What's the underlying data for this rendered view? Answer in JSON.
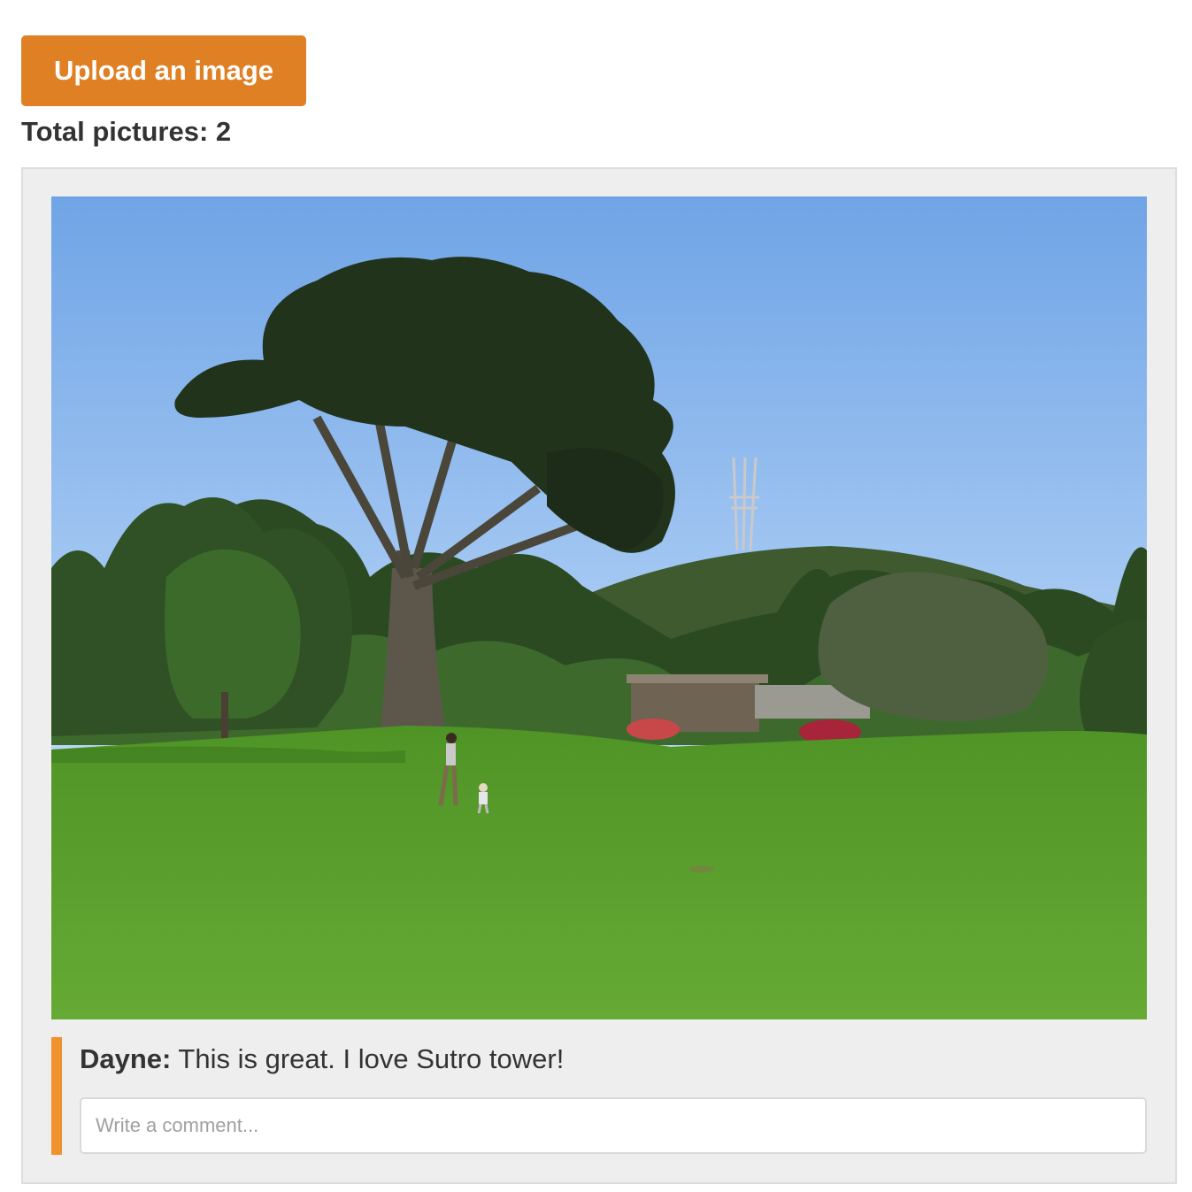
{
  "upload_button": {
    "label": "Upload an image"
  },
  "summary": {
    "total_label": "Total pictures: 2"
  },
  "post": {
    "image": {
      "subject": "park lawn with large cypress tree, person and child walking, Sutro tower on hill",
      "colors": {
        "sky_top": "#7fb0ea",
        "sky_bottom": "#c5defa",
        "grass": "#5a9e2c",
        "tree": "#22331c"
      }
    },
    "comments": [
      {
        "author": "Dayne:",
        "text": " This is great. I love Sutro tower!"
      }
    ],
    "comment_input": {
      "value": "",
      "placeholder": "Write a comment..."
    }
  },
  "colors": {
    "accent": "#e08025",
    "comment_bar": "#f0922e",
    "card_bg": "#eeeeee"
  }
}
